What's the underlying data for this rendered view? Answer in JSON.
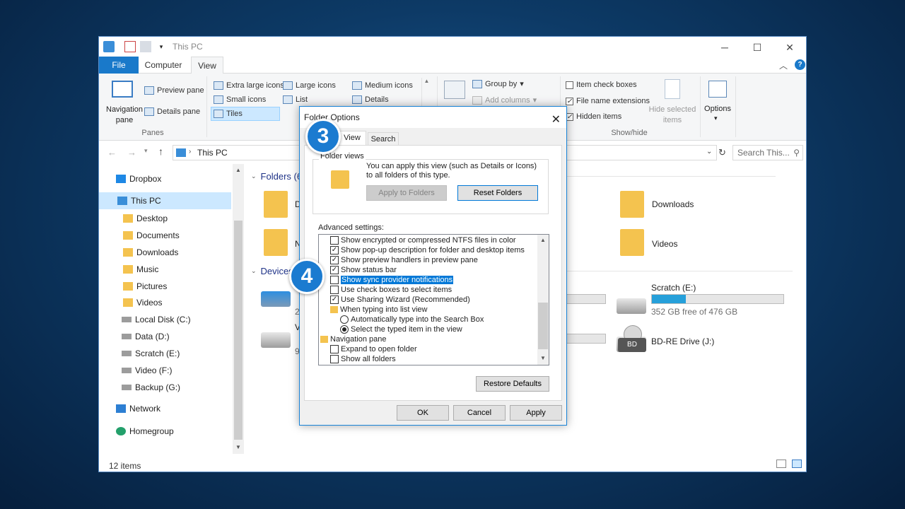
{
  "explorer": {
    "title": "This PC",
    "tabs": [
      "File",
      "Computer",
      "View"
    ],
    "ribbon": {
      "navigation_pane_label": "Navigation pane",
      "preview_pane": "Preview pane",
      "details_pane": "Details pane",
      "panes_group": "Panes",
      "layout_items": [
        "Extra large icons",
        "Large icons",
        "Medium icons",
        "Small icons",
        "List",
        "Details",
        "Tiles"
      ],
      "group_by": "Group by",
      "add_columns": "Add columns",
      "item_check_boxes": "Item check boxes",
      "file_name_extensions": "File name extensions",
      "hidden_items": "Hidden items",
      "hide_selected_items": "Hide selected items",
      "options": "Options",
      "showhide_group": "Show/hide"
    },
    "address": {
      "path": "This PC",
      "search_placeholder": "Search This..."
    },
    "nav": [
      {
        "label": "Dropbox",
        "icon": "dropbox-icon"
      },
      {
        "label": "This PC",
        "icon": "computer-icon",
        "selected": true
      },
      {
        "label": "Desktop",
        "icon": "folder-icon"
      },
      {
        "label": "Documents",
        "icon": "folder-icon"
      },
      {
        "label": "Downloads",
        "icon": "folder-icon"
      },
      {
        "label": "Music",
        "icon": "folder-icon"
      },
      {
        "label": "Pictures",
        "icon": "folder-icon"
      },
      {
        "label": "Videos",
        "icon": "folder-icon"
      },
      {
        "label": "Local Disk (C:)",
        "icon": "drive-icon"
      },
      {
        "label": "Data (D:)",
        "icon": "drive-icon"
      },
      {
        "label": "Scratch (E:)",
        "icon": "drive-icon"
      },
      {
        "label": "Video (F:)",
        "icon": "drive-icon"
      },
      {
        "label": "Backup (G:)",
        "icon": "drive-icon"
      },
      {
        "label": "Network",
        "icon": "network-icon"
      },
      {
        "label": "Homegroup",
        "icon": "homegroup-icon"
      }
    ],
    "content": {
      "folders_header": "Folders (6)",
      "devices_header": "Devices",
      "downloads": "Downloads",
      "videos": "Videos",
      "scratch": "Scratch (E:)",
      "scratch_free": "352 GB free of 476 GB",
      "scratch_used_fraction": 0.26,
      "bd_drive": "BD-RE Drive (J:)",
      "bd_label": "BD",
      "partial_d": "D",
      "partial_n": "N",
      "partial_2": "2",
      "partial_v": "V",
      "partial_9": "9"
    },
    "status": {
      "items": "12 items"
    }
  },
  "dialog": {
    "title": "Folder Options",
    "tabs": [
      "View",
      "Search"
    ],
    "folder_views_label": "Folder views",
    "folder_views_text": "You can apply this view (such as Details or Icons) to all folders of this type.",
    "apply_to_folders": "Apply to Folders",
    "reset_folders": "Reset Folders",
    "advanced_label": "Advanced settings:",
    "settings": [
      {
        "type": "checkbox",
        "checked": false,
        "label": "Show encrypted or compressed NTFS files in color"
      },
      {
        "type": "checkbox",
        "checked": true,
        "label": "Show pop-up description for folder and desktop items"
      },
      {
        "type": "checkbox",
        "checked": true,
        "label": "Show preview handlers in preview pane"
      },
      {
        "type": "checkbox",
        "checked": true,
        "label": "Show status bar"
      },
      {
        "type": "checkbox",
        "checked": false,
        "label": "Show sync provider notifications",
        "highlighted": true
      },
      {
        "type": "checkbox",
        "checked": false,
        "label": "Use check boxes to select items"
      },
      {
        "type": "checkbox",
        "checked": true,
        "label": "Use Sharing Wizard (Recommended)"
      },
      {
        "type": "group",
        "label": "When typing into list view"
      },
      {
        "type": "radio",
        "checked": false,
        "label": "Automatically type into the Search Box"
      },
      {
        "type": "radio",
        "checked": true,
        "label": "Select the typed item in the view"
      },
      {
        "type": "root",
        "label": "Navigation pane"
      },
      {
        "type": "checkbox",
        "checked": false,
        "label": "Expand to open folder"
      },
      {
        "type": "checkbox",
        "checked": false,
        "label": "Show all folders"
      }
    ],
    "restore_defaults": "Restore Defaults",
    "ok": "OK",
    "cancel": "Cancel",
    "apply": "Apply"
  },
  "badges": {
    "step3": "3",
    "step4": "4"
  },
  "colors": {
    "accent": "#1979ca",
    "badge": "#1b7bd0",
    "selection": "#0078d7"
  }
}
